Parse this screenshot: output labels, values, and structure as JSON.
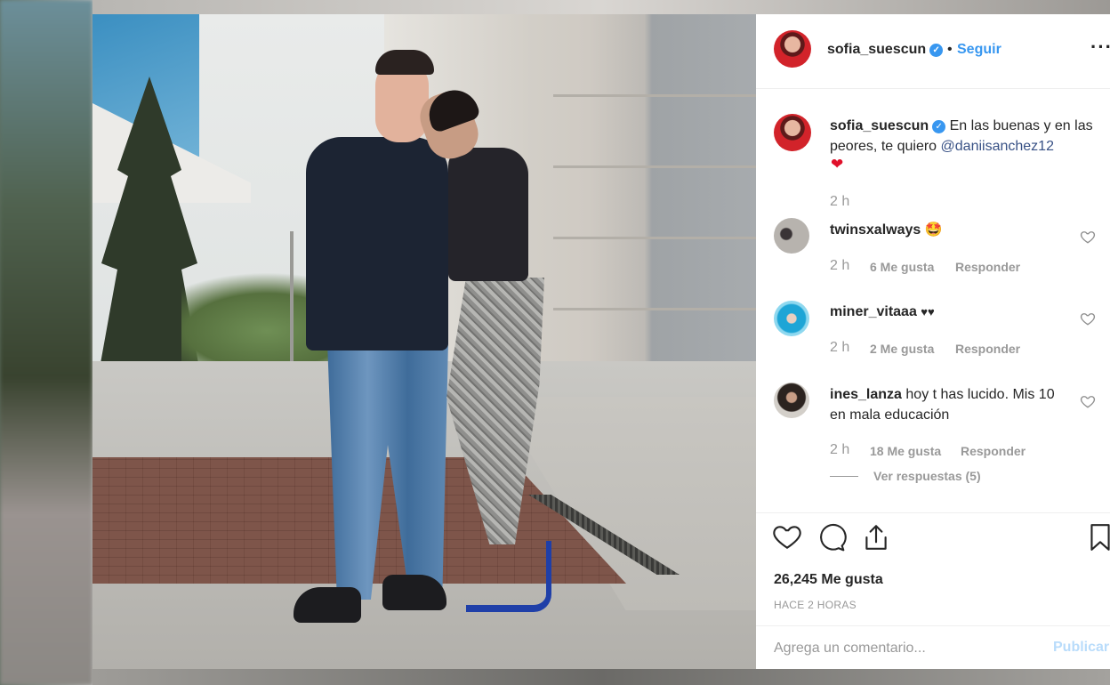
{
  "post": {
    "author": "sofia_suescun",
    "separator": "•",
    "follow_label": "Seguir",
    "more_label": "···",
    "caption_user": "sofia_suescun",
    "caption_text": "En las buenas y en las peores, te quiero ",
    "caption_mention": "@daniisanchez12",
    "caption_emoji": "❤",
    "caption_time": "2 h"
  },
  "comments": [
    {
      "user": "twinsxalways",
      "text": "",
      "emoji": "🤩",
      "time": "2 h",
      "likes": "6 Me gusta",
      "reply": "Responder"
    },
    {
      "user": "miner_vitaaa",
      "text": "",
      "emoji": "♥♥",
      "time": "2 h",
      "likes": "2 Me gusta",
      "reply": "Responder"
    },
    {
      "user": "ines_lanza",
      "text": "hoy t has lucido. Mis 10 en mala educación",
      "emoji": "",
      "time": "2 h",
      "likes": "18 Me gusta",
      "reply": "Responder",
      "replies": "Ver respuestas (5)"
    }
  ],
  "footer": {
    "likes": "26,245 Me gusta",
    "ago": "HACE 2 HORAS",
    "comment_placeholder": "Agrega un comentario...",
    "publish_label": "Publicar"
  },
  "colors": {
    "accent": "#3897f0",
    "text": "#262626",
    "muted": "#999999",
    "heart": "#e0102a"
  },
  "icons": [
    "verified-badge-icon",
    "heart-icon",
    "comment-icon",
    "share-icon",
    "bookmark-icon"
  ]
}
